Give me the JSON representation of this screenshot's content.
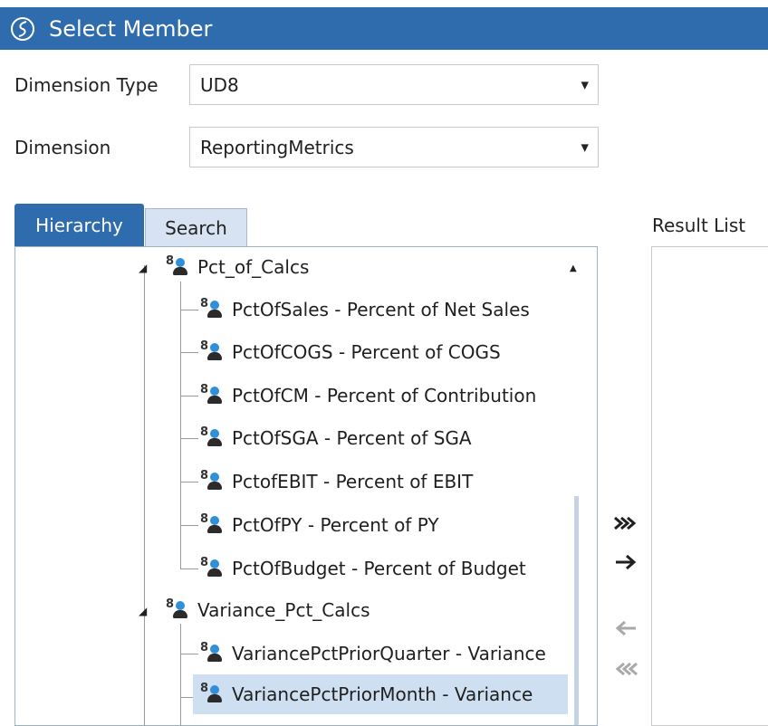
{
  "window": {
    "title": "Select Member"
  },
  "dimension_type": {
    "label": "Dimension Type",
    "value": "UD8"
  },
  "dimension": {
    "label": "Dimension",
    "value": "ReportingMetrics"
  },
  "tabs": {
    "hierarchy": "Hierarchy",
    "search": "Search"
  },
  "tree": {
    "groups": [
      {
        "label": "Pct_of_Calcs",
        "children": [
          "PctOfSales - Percent of Net Sales",
          "PctOfCOGS - Percent of COGS",
          "PctOfCM - Percent of Contribution",
          "PctOfSGA - Percent of SGA",
          "PctofEBIT - Percent of EBIT",
          "PctOfPY - Percent of PY",
          "PctOfBudget - Percent of Budget"
        ]
      },
      {
        "label": "Variance_Pct_Calcs",
        "children": [
          "VariancePctPriorQuarter - Variance",
          "VariancePctPriorMonth - Variance"
        ]
      }
    ],
    "icon_number": "8",
    "selected": "VariancePctPriorMonth - Variance"
  },
  "result_list": {
    "label": "Result List"
  },
  "colors": {
    "title_bar": "#2f6cad",
    "tab_active": "#2f6cad",
    "tab_inactive": "#d7e3f2",
    "selection": "#cfdff2"
  }
}
